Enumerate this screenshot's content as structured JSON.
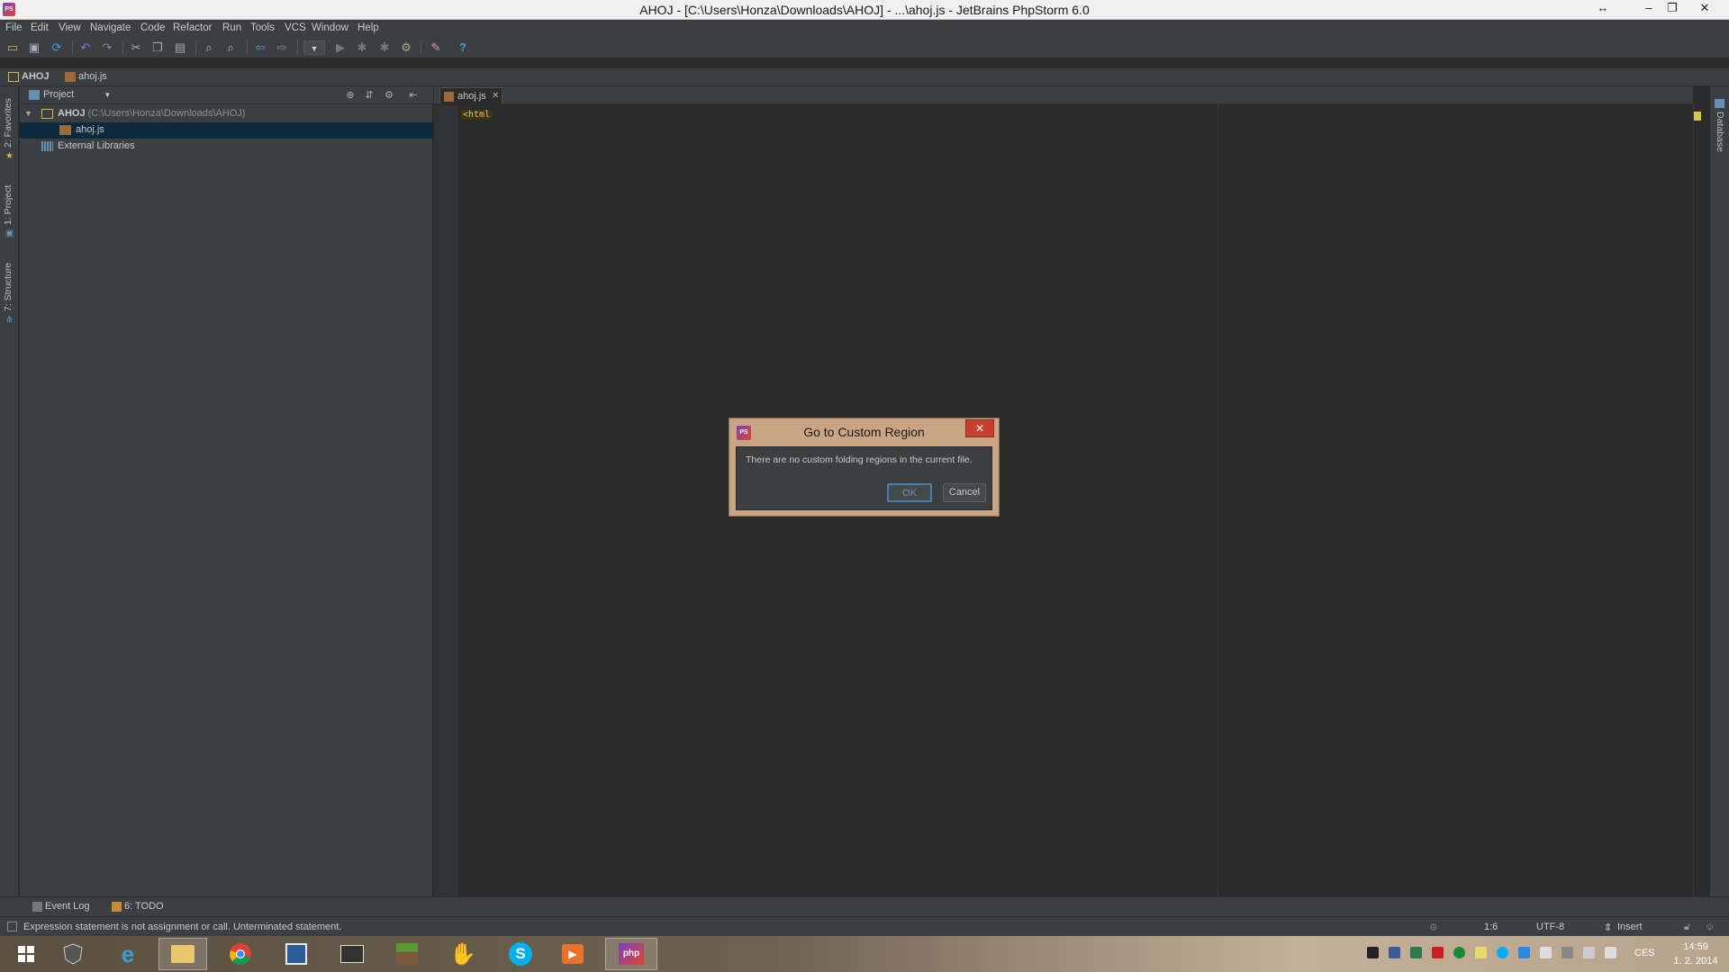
{
  "window": {
    "title": "AHOJ - [C:\\Users\\Honza\\Downloads\\AHOJ] - ...\\ahoj.js - JetBrains PhpStorm 6.0",
    "controls": [
      "↔",
      "–",
      "❐",
      "✕"
    ]
  },
  "menu": [
    "File",
    "Edit",
    "View",
    "Navigate",
    "Code",
    "Refactor",
    "Run",
    "Tools",
    "VCS",
    "Window",
    "Help"
  ],
  "breadcrumb": [
    "AHOJ",
    "ahoj.js"
  ],
  "left_tabs": {
    "favorites": "2: Favorites",
    "project": "1: Project",
    "structure": "7: Structure"
  },
  "project_panel": {
    "title": "Project",
    "tree": [
      {
        "label": "AHOJ",
        "path": "(C:\\Users\\Honza\\Downloads\\AHOJ)"
      },
      {
        "label": "ahoj.js",
        "path": ""
      },
      {
        "label": "External Libraries",
        "path": ""
      }
    ]
  },
  "editor": {
    "tab_label": "ahoj.js",
    "code_line": "<html"
  },
  "right_tabs": {
    "database": "Database"
  },
  "bottom_tools": {
    "event_log": "Event Log",
    "todo": "6: TODO"
  },
  "status": {
    "message": "Expression statement is not assignment or call. Unterminated statement.",
    "position": "1:6",
    "encoding": "UTF-8",
    "mode": "Insert"
  },
  "dialog": {
    "title": "Go to Custom Region",
    "message": "There are no custom folding regions in the current file.",
    "ok_label": "OK",
    "cancel_label": "Cancel"
  },
  "taskbar": {
    "language": "CES",
    "time": "14:59",
    "date": "1. 2. 2014"
  },
  "colors": {
    "ide_background": "#2b2b2b",
    "panel_background": "#3c3f41",
    "selection": "#0d293e",
    "dialog_frame": "#c9a586",
    "close_button": "#c7402f",
    "code_tag": "#e8bf6a"
  }
}
